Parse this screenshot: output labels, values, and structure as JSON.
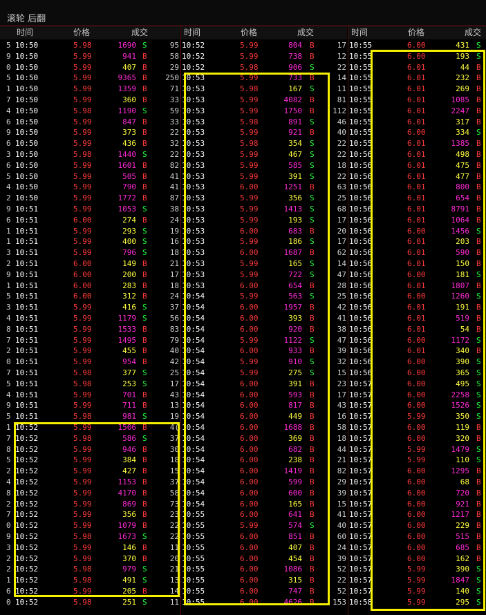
{
  "window": {
    "title": "滚轮 后翻"
  },
  "headers": {
    "time": "时间",
    "price": "价格",
    "volume": "成交"
  },
  "columns": [
    {
      "rows": [
        [
          "5",
          "10:50",
          "5.98",
          "1690",
          "S",
          "95"
        ],
        [
          "9",
          "10:50",
          "5.99",
          "941",
          "B",
          "58"
        ],
        [
          "0",
          "10:50",
          "5.99",
          "407",
          "B",
          "29"
        ],
        [
          "5",
          "10:50",
          "5.99",
          "9365",
          "B",
          "250"
        ],
        [
          "1",
          "10:50",
          "5.99",
          "1359",
          "B",
          "71"
        ],
        [
          "7",
          "10:50",
          "5.99",
          "360",
          "B",
          "33"
        ],
        [
          "4",
          "10:50",
          "5.98",
          "1190",
          "S",
          "59"
        ],
        [
          "6",
          "10:50",
          "5.99",
          "847",
          "B",
          "33"
        ],
        [
          "9",
          "10:50",
          "5.99",
          "373",
          "B",
          "22"
        ],
        [
          "6",
          "10:50",
          "5.99",
          "436",
          "B",
          "32"
        ],
        [
          "3",
          "10:50",
          "5.98",
          "1440",
          "S",
          "22"
        ],
        [
          "6",
          "10:50",
          "5.99",
          "1601",
          "B",
          "82"
        ],
        [
          "5",
          "10:50",
          "5.99",
          "505",
          "B",
          "41"
        ],
        [
          "4",
          "10:50",
          "5.99",
          "790",
          "B",
          "41"
        ],
        [
          "2",
          "10:50",
          "5.99",
          "1772",
          "B",
          "87"
        ],
        [
          "9",
          "10:51",
          "5.99",
          "1053",
          "S",
          "38"
        ],
        [
          "6",
          "10:51",
          "6.00",
          "274",
          "B",
          "24"
        ],
        [
          "1",
          "10:51",
          "5.99",
          "293",
          "S",
          "19"
        ],
        [
          "1",
          "10:51",
          "5.99",
          "400",
          "S",
          "16"
        ],
        [
          "3",
          "10:51",
          "5.99",
          "796",
          "S",
          "18"
        ],
        [
          "2",
          "10:51",
          "6.00",
          "149",
          "B",
          "21"
        ],
        [
          "9",
          "10:51",
          "6.00",
          "200",
          "B",
          "17"
        ],
        [
          "1",
          "10:51",
          "6.00",
          "283",
          "B",
          "18"
        ],
        [
          "5",
          "10:51",
          "6.00",
          "312",
          "B",
          "24"
        ],
        [
          "3",
          "10:51",
          "5.99",
          "416",
          "S",
          "37"
        ],
        [
          "4",
          "10:51",
          "5.99",
          "1179",
          "S",
          "56"
        ],
        [
          "8",
          "10:51",
          "5.99",
          "1533",
          "B",
          "83"
        ],
        [
          "7",
          "10:51",
          "5.99",
          "1495",
          "B",
          "79"
        ],
        [
          "2",
          "10:51",
          "5.99",
          "455",
          "B",
          "40"
        ],
        [
          "0",
          "10:51",
          "5.99",
          "954",
          "B",
          "42"
        ],
        [
          "7",
          "10:51",
          "5.98",
          "377",
          "S",
          "25"
        ],
        [
          "5",
          "10:51",
          "5.98",
          "253",
          "S",
          "17"
        ],
        [
          "4",
          "10:51",
          "5.99",
          "701",
          "B",
          "43"
        ],
        [
          "9",
          "10:51",
          "5.99",
          "711",
          "B",
          "13"
        ],
        [
          "5",
          "10:51",
          "5.98",
          "981",
          "S",
          "19"
        ],
        [
          "1",
          "10:52",
          "5.99",
          "1506",
          "B",
          "4("
        ],
        [
          "7",
          "10:52",
          "5.98",
          "586",
          "S",
          "37"
        ],
        [
          "8",
          "10:52",
          "5.99",
          "946",
          "B",
          "30"
        ],
        [
          "5",
          "10:52",
          "5.99",
          "384",
          "B",
          "18"
        ],
        [
          "2",
          "10:52",
          "5.99",
          "427",
          "B",
          "15"
        ],
        [
          "4",
          "10:52",
          "5.99",
          "1153",
          "B",
          "37"
        ],
        [
          "8",
          "10:52",
          "5.99",
          "4170",
          "B",
          "58"
        ],
        [
          "2",
          "10:52",
          "5.99",
          "869",
          "B",
          "73"
        ],
        [
          "7",
          "10:52",
          "5.99",
          "356",
          "B",
          "23"
        ],
        [
          "0",
          "10:52",
          "5.99",
          "1079",
          "B",
          "22"
        ],
        [
          "9",
          "10:52",
          "5.98",
          "1673",
          "S",
          "22"
        ],
        [
          "3",
          "10:52",
          "5.99",
          "146",
          "B",
          "11"
        ],
        [
          "2",
          "10:52",
          "5.99",
          "370",
          "B",
          "20"
        ],
        [
          "2",
          "10:52",
          "5.98",
          "979",
          "S",
          "21"
        ],
        [
          "1",
          "10:52",
          "5.98",
          "491",
          "S",
          "13"
        ],
        [
          "6",
          "10:52",
          "5.99",
          "205",
          "B",
          "14"
        ],
        [
          "0",
          "10:52",
          "5.98",
          "251",
          "S",
          "11"
        ]
      ]
    },
    {
      "rows": [
        [
          "10:52",
          "5.99",
          "804",
          "B",
          "17"
        ],
        [
          "10:52",
          "5.99",
          "738",
          "B",
          "12"
        ],
        [
          "10:52",
          "5.98",
          "906",
          "S",
          "22"
        ],
        [
          "10:53",
          "5.99",
          "733",
          "B",
          "14"
        ],
        [
          "10:53",
          "5.98",
          "167",
          "S",
          "11"
        ],
        [
          "10:53",
          "5.99",
          "4082",
          "B",
          "81"
        ],
        [
          "10:53",
          "5.99",
          "1750",
          "B",
          "112"
        ],
        [
          "10:53",
          "5.98",
          "891",
          "S",
          "46"
        ],
        [
          "10:53",
          "5.99",
          "921",
          "B",
          "40"
        ],
        [
          "10:53",
          "5.98",
          "354",
          "S",
          "22"
        ],
        [
          "10:53",
          "5.99",
          "467",
          "S",
          "22"
        ],
        [
          "10:53",
          "5.99",
          "585",
          "S",
          "18"
        ],
        [
          "10:53",
          "5.99",
          "391",
          "S",
          "22"
        ],
        [
          "10:53",
          "6.00",
          "1251",
          "B",
          "63"
        ],
        [
          "10:53",
          "5.99",
          "356",
          "S",
          "25"
        ],
        [
          "10:53",
          "5.99",
          "1413",
          "S",
          "68"
        ],
        [
          "10:53",
          "5.99",
          "193",
          "S",
          "17"
        ],
        [
          "10:53",
          "6.00",
          "683",
          "B",
          "20"
        ],
        [
          "10:53",
          "5.99",
          "186",
          "S",
          "17"
        ],
        [
          "10:53",
          "6.00",
          "1687",
          "B",
          "62"
        ],
        [
          "10:53",
          "5.99",
          "165",
          "S",
          "14"
        ],
        [
          "10:53",
          "5.99",
          "722",
          "S",
          "47"
        ],
        [
          "10:53",
          "6.00",
          "654",
          "B",
          "28"
        ],
        [
          "10:54",
          "5.99",
          "563",
          "S",
          "25"
        ],
        [
          "10:54",
          "6.00",
          "1957",
          "B",
          "42"
        ],
        [
          "10:54",
          "6.00",
          "393",
          "B",
          "41"
        ],
        [
          "10:54",
          "6.00",
          "920",
          "B",
          "38"
        ],
        [
          "10:54",
          "5.99",
          "1122",
          "S",
          "47"
        ],
        [
          "10:54",
          "6.00",
          "933",
          "B",
          "39"
        ],
        [
          "10:54",
          "5.99",
          "910",
          "S",
          "32"
        ],
        [
          "10:54",
          "5.99",
          "275",
          "S",
          "15"
        ],
        [
          "10:54",
          "6.00",
          "391",
          "B",
          "23"
        ],
        [
          "10:54",
          "6.00",
          "593",
          "B",
          "17"
        ],
        [
          "10:54",
          "6.00",
          "817",
          "B",
          "43"
        ],
        [
          "10:54",
          "6.00",
          "449",
          "B",
          "16"
        ],
        [
          "10:54",
          "6.00",
          "1688",
          "B",
          "58"
        ],
        [
          "10:54",
          "6.00",
          "369",
          "B",
          "18"
        ],
        [
          "10:54",
          "6.00",
          "682",
          "B",
          "44"
        ],
        [
          "10:54",
          "6.00",
          "238",
          "B",
          "21"
        ],
        [
          "10:54",
          "6.00",
          "1419",
          "B",
          "82"
        ],
        [
          "10:54",
          "6.00",
          "599",
          "B",
          "29"
        ],
        [
          "10:54",
          "6.00",
          "600",
          "B",
          "39"
        ],
        [
          "10:54",
          "6.00",
          "165",
          "B",
          "15"
        ],
        [
          "10:55",
          "6.00",
          "641",
          "B",
          "41"
        ],
        [
          "10:55",
          "5.99",
          "574",
          "S",
          "40"
        ],
        [
          "10:55",
          "6.00",
          "851",
          "B",
          "60"
        ],
        [
          "10:55",
          "6.00",
          "407",
          "B",
          "24"
        ],
        [
          "10:55",
          "6.00",
          "454",
          "B",
          "39"
        ],
        [
          "10:55",
          "6.00",
          "1086",
          "B",
          "52"
        ],
        [
          "10:55",
          "6.00",
          "315",
          "B",
          "22"
        ],
        [
          "10:55",
          "6.00",
          "747",
          "B",
          "52"
        ],
        [
          "10:55",
          "6.00",
          "4626",
          "B",
          "153"
        ]
      ]
    },
    {
      "rows": [
        [
          "10:55",
          "6.00",
          "431",
          "S"
        ],
        [
          "10:55",
          "6.00",
          "193",
          "S"
        ],
        [
          "10:55",
          "6.01",
          "44",
          "B"
        ],
        [
          "10:55",
          "6.01",
          "232",
          "B"
        ],
        [
          "10:55",
          "6.01",
          "269",
          "B"
        ],
        [
          "10:55",
          "6.01",
          "1085",
          "B"
        ],
        [
          "10:55",
          "6.01",
          "2247",
          "B"
        ],
        [
          "10:55",
          "6.01",
          "317",
          "B"
        ],
        [
          "10:55",
          "6.00",
          "334",
          "S"
        ],
        [
          "10:55",
          "6.01",
          "1385",
          "B"
        ],
        [
          "10:56",
          "6.01",
          "498",
          "B"
        ],
        [
          "10:56",
          "6.01",
          "475",
          "B"
        ],
        [
          "10:56",
          "6.01",
          "477",
          "B"
        ],
        [
          "10:56",
          "6.01",
          "800",
          "B"
        ],
        [
          "10:56",
          "6.01",
          "654",
          "B"
        ],
        [
          "10:56",
          "6.01",
          "8791",
          "B"
        ],
        [
          "10:56",
          "6.01",
          "1064",
          "B"
        ],
        [
          "10:56",
          "6.00",
          "1456",
          "S"
        ],
        [
          "10:56",
          "6.01",
          "203",
          "B"
        ],
        [
          "10:56",
          "6.01",
          "590",
          "B"
        ],
        [
          "10:56",
          "6.01",
          "150",
          "B"
        ],
        [
          "10:56",
          "6.00",
          "181",
          "S"
        ],
        [
          "10:56",
          "6.01",
          "1807",
          "B"
        ],
        [
          "10:56",
          "6.00",
          "1260",
          "S"
        ],
        [
          "10:56",
          "6.01",
          "191",
          "B"
        ],
        [
          "10:56",
          "6.01",
          "519",
          "B"
        ],
        [
          "10:56",
          "6.01",
          "54",
          "B"
        ],
        [
          "10:56",
          "6.00",
          "1172",
          "S"
        ],
        [
          "10:56",
          "6.01",
          "340",
          "B"
        ],
        [
          "10:56",
          "6.00",
          "390",
          "S"
        ],
        [
          "10:56",
          "6.00",
          "365",
          "S"
        ],
        [
          "10:57",
          "6.00",
          "495",
          "S"
        ],
        [
          "10:57",
          "6.00",
          "2258",
          "S"
        ],
        [
          "10:57",
          "6.00",
          "1526",
          "S"
        ],
        [
          "10:57",
          "5.99",
          "350",
          "S"
        ],
        [
          "10:57",
          "6.00",
          "119",
          "B"
        ],
        [
          "10:57",
          "6.00",
          "320",
          "B"
        ],
        [
          "10:57",
          "5.99",
          "1479",
          "S"
        ],
        [
          "10:57",
          "5.99",
          "110",
          "S"
        ],
        [
          "10:57",
          "6.00",
          "1295",
          "B"
        ],
        [
          "10:57",
          "6.00",
          "68",
          "B"
        ],
        [
          "10:57",
          "6.00",
          "720",
          "B"
        ],
        [
          "10:57",
          "6.00",
          "921",
          "B"
        ],
        [
          "10:57",
          "6.00",
          "1217",
          "B"
        ],
        [
          "10:57",
          "6.00",
          "229",
          "B"
        ],
        [
          "10:57",
          "6.00",
          "515",
          "B"
        ],
        [
          "10:57",
          "6.00",
          "685",
          "B"
        ],
        [
          "10:57",
          "6.00",
          "162",
          "B"
        ],
        [
          "10:57",
          "5.99",
          "390",
          "S"
        ],
        [
          "10:57",
          "5.99",
          "1847",
          "S"
        ],
        [
          "10:57",
          "5.99",
          "140",
          "S"
        ],
        [
          "10:58",
          "5.99",
          "295",
          "S"
        ]
      ]
    }
  ],
  "colors": {
    "background": "#000000",
    "time": "#ffffff",
    "price": "#ff3a3a",
    "volume_large": "#ff2bd6",
    "volume_small": "#ffff40",
    "buy": "#ff3a3a",
    "sell": "#21ff3a",
    "highlight": "#f4f000"
  }
}
